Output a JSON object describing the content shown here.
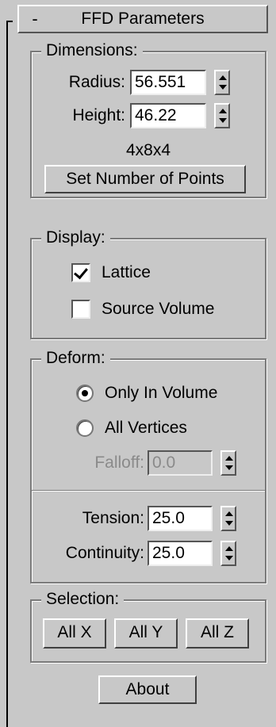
{
  "rollout": {
    "toggle": "-",
    "title": "FFD Parameters"
  },
  "dimensions": {
    "label": "Dimensions:",
    "radius_label": "Radius:",
    "radius_value": "56.551",
    "height_label": "Height:",
    "height_value": "46.22",
    "points_text": "4x8x4",
    "set_points_button": "Set Number of Points"
  },
  "display": {
    "label": "Display:",
    "lattice_label": "Lattice",
    "lattice_checked": true,
    "source_volume_label": "Source Volume",
    "source_volume_checked": false
  },
  "deform": {
    "label": "Deform:",
    "only_in_volume_label": "Only In Volume",
    "all_vertices_label": "All Vertices",
    "selected": "Only In Volume",
    "falloff_label": "Falloff:",
    "falloff_value": "0.0",
    "tension_label": "Tension:",
    "tension_value": "25.0",
    "continuity_label": "Continuity:",
    "continuity_value": "25.0"
  },
  "selection": {
    "label": "Selection:",
    "all_x": "All X",
    "all_y": "All Y",
    "all_z": "All Z"
  },
  "about_button": "About"
}
